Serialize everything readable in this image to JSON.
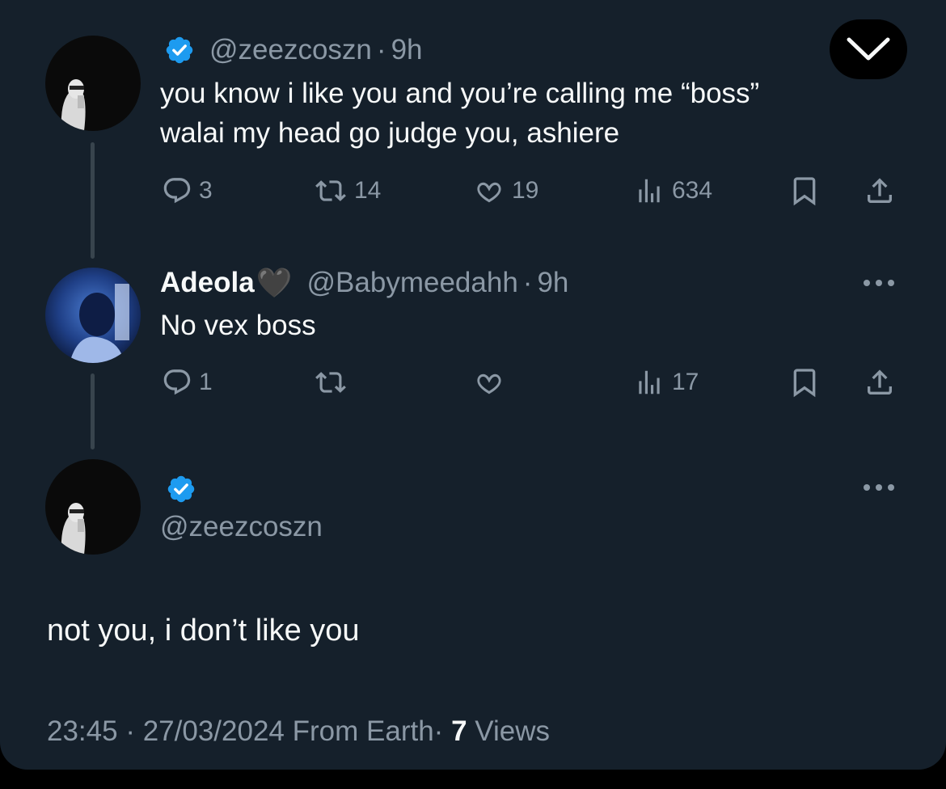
{
  "tweet1": {
    "handle": "@zeezcoszn",
    "time": "9h",
    "line1": "you know i like you and you’re calling me “boss”",
    "line2": "walai my head go judge you, ashiere",
    "replies": "3",
    "retweets": "14",
    "likes": "19",
    "views": "634"
  },
  "tweet2": {
    "name": "Adeola",
    "emoji": "🖤",
    "handle": "@Babymeedahh",
    "time": "9h",
    "text": "No vex boss",
    "replies": "1",
    "views": "17"
  },
  "tweet3": {
    "handle": "@zeezcoszn",
    "text": "not you, i don’t like you",
    "time": "23:45",
    "date": "27/03/2024",
    "source": "From Earth",
    "views_count": "7",
    "views_label": "Views"
  },
  "colors": {
    "background": "#15202b",
    "verified": "#1d9bf0",
    "muted": "#8b98a5",
    "text": "#f7f9f9"
  },
  "icons": [
    "verified-badge-icon",
    "reply-icon",
    "retweet-icon",
    "like-icon",
    "views-icon",
    "bookmark-icon",
    "share-icon",
    "more-icon",
    "chevron-down-icon"
  ]
}
